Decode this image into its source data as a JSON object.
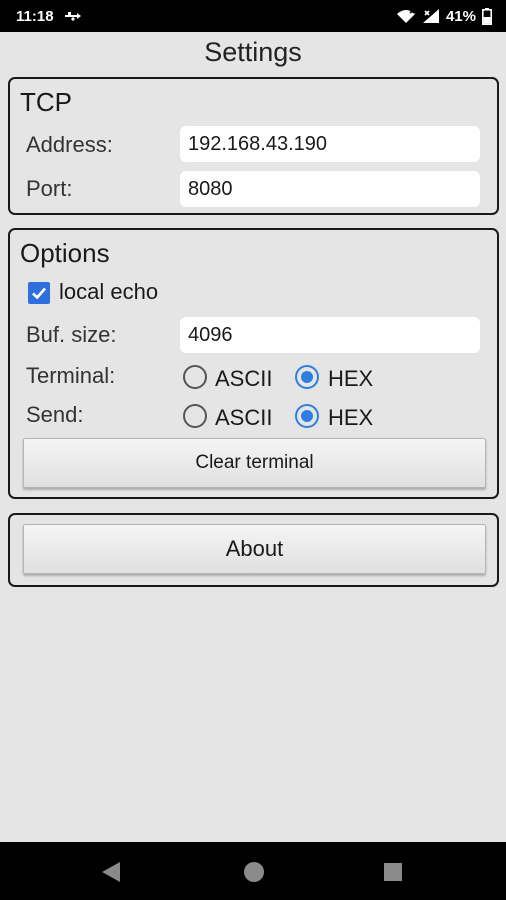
{
  "status_bar": {
    "time": "11:18",
    "battery": "41%",
    "icons": [
      "usb-debug-icon",
      "wifi-icon",
      "signal-icon",
      "battery-icon"
    ]
  },
  "title": "Settings",
  "tcp": {
    "title": "TCP",
    "address_label": "Address:",
    "address_value": "192.168.43.190",
    "port_label": "Port:",
    "port_value": "8080"
  },
  "options": {
    "title": "Options",
    "local_echo_label": "local echo",
    "local_echo_checked": true,
    "buf_size_label": "Buf. size:",
    "buf_size_value": "4096",
    "terminal_label": "Terminal:",
    "send_label": "Send:",
    "mode_ascii": "ASCII",
    "mode_hex": "HEX",
    "terminal_mode": "HEX",
    "send_mode": "HEX",
    "clear_button": "Clear terminal"
  },
  "about": {
    "button": "About"
  },
  "nav": {
    "icons": [
      "back-icon",
      "home-icon",
      "recents-icon"
    ]
  },
  "colors": {
    "accent": "#2f7fe0",
    "background": "#e5e5e5",
    "bars": "#000000"
  }
}
